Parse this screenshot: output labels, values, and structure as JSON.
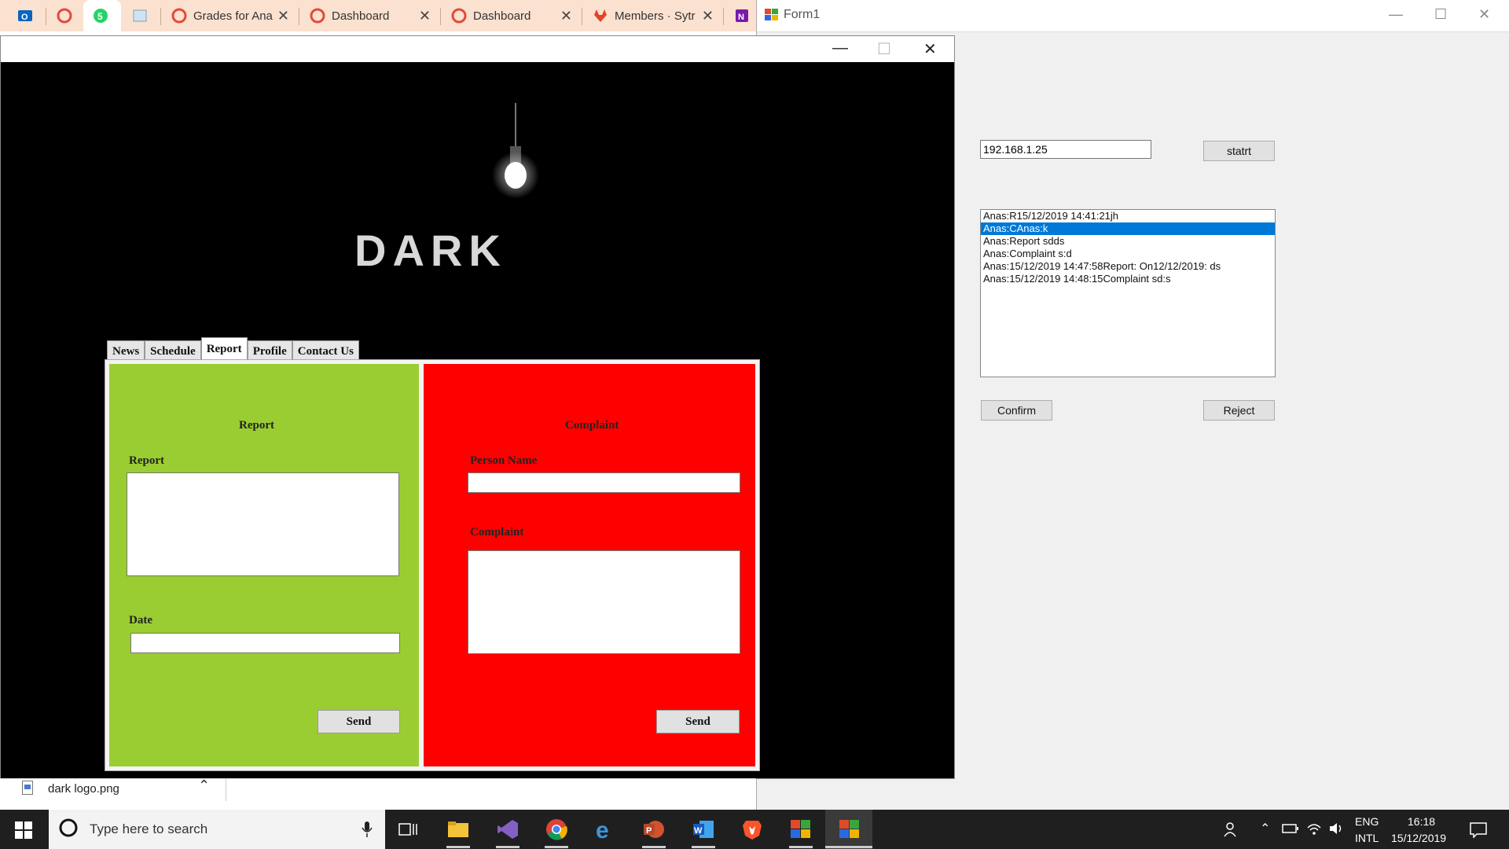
{
  "browser": {
    "tabs": [
      {
        "title": "",
        "icon": "outlook-icon"
      },
      {
        "title": "",
        "icon": "moodle-icon"
      },
      {
        "title": "",
        "icon": "whatsapp-icon"
      },
      {
        "title": "",
        "icon": "image-icon"
      },
      {
        "title": "Grades for Ana",
        "icon": "moodle-icon"
      },
      {
        "title": "Dashboard",
        "icon": "moodle-icon"
      },
      {
        "title": "Dashboard",
        "icon": "moodle-icon"
      },
      {
        "title": "Members · Sytr",
        "icon": "gitlab-icon"
      },
      {
        "title": "",
        "icon": "onenote-icon"
      }
    ],
    "download": {
      "filename": "dark logo.png"
    }
  },
  "dark_app": {
    "logo_text": "DARK",
    "tabs": [
      "News",
      "Schedule",
      "Report",
      "Profile",
      "Contact Us"
    ],
    "selected_tab": "Report",
    "report_panel": {
      "heading": "Report",
      "report_label": "Report",
      "report_value": "",
      "date_label": "Date",
      "date_value": "",
      "send_label": "Send",
      "color": "#9acd32"
    },
    "complaint_panel": {
      "heading": "Complaint",
      "person_label": "Person Name",
      "person_value": "",
      "complaint_label": "Complaint",
      "complaint_value": "",
      "send_label": "Send",
      "color": "#ff0000"
    }
  },
  "form1": {
    "title": "Form1",
    "ip_value": "192.168.1.25",
    "start_label": "statrt",
    "list_items": [
      "Anas:R15/12/2019 14:41:21jh",
      "Anas:CAnas:k",
      "Anas:Report sdds",
      "Anas:Complaint s:d",
      "Anas:15/12/2019 14:47:58Report: On12/12/2019: ds",
      "Anas:15/12/2019 14:48:15Complaint sd:s"
    ],
    "selected_index": 1,
    "confirm_label": "Confirm",
    "reject_label": "Reject"
  },
  "taskbar": {
    "search_placeholder": "Type here to search",
    "lang_top": "ENG",
    "lang_bottom": "INTL",
    "time": "16:18",
    "date": "15/12/2019"
  }
}
